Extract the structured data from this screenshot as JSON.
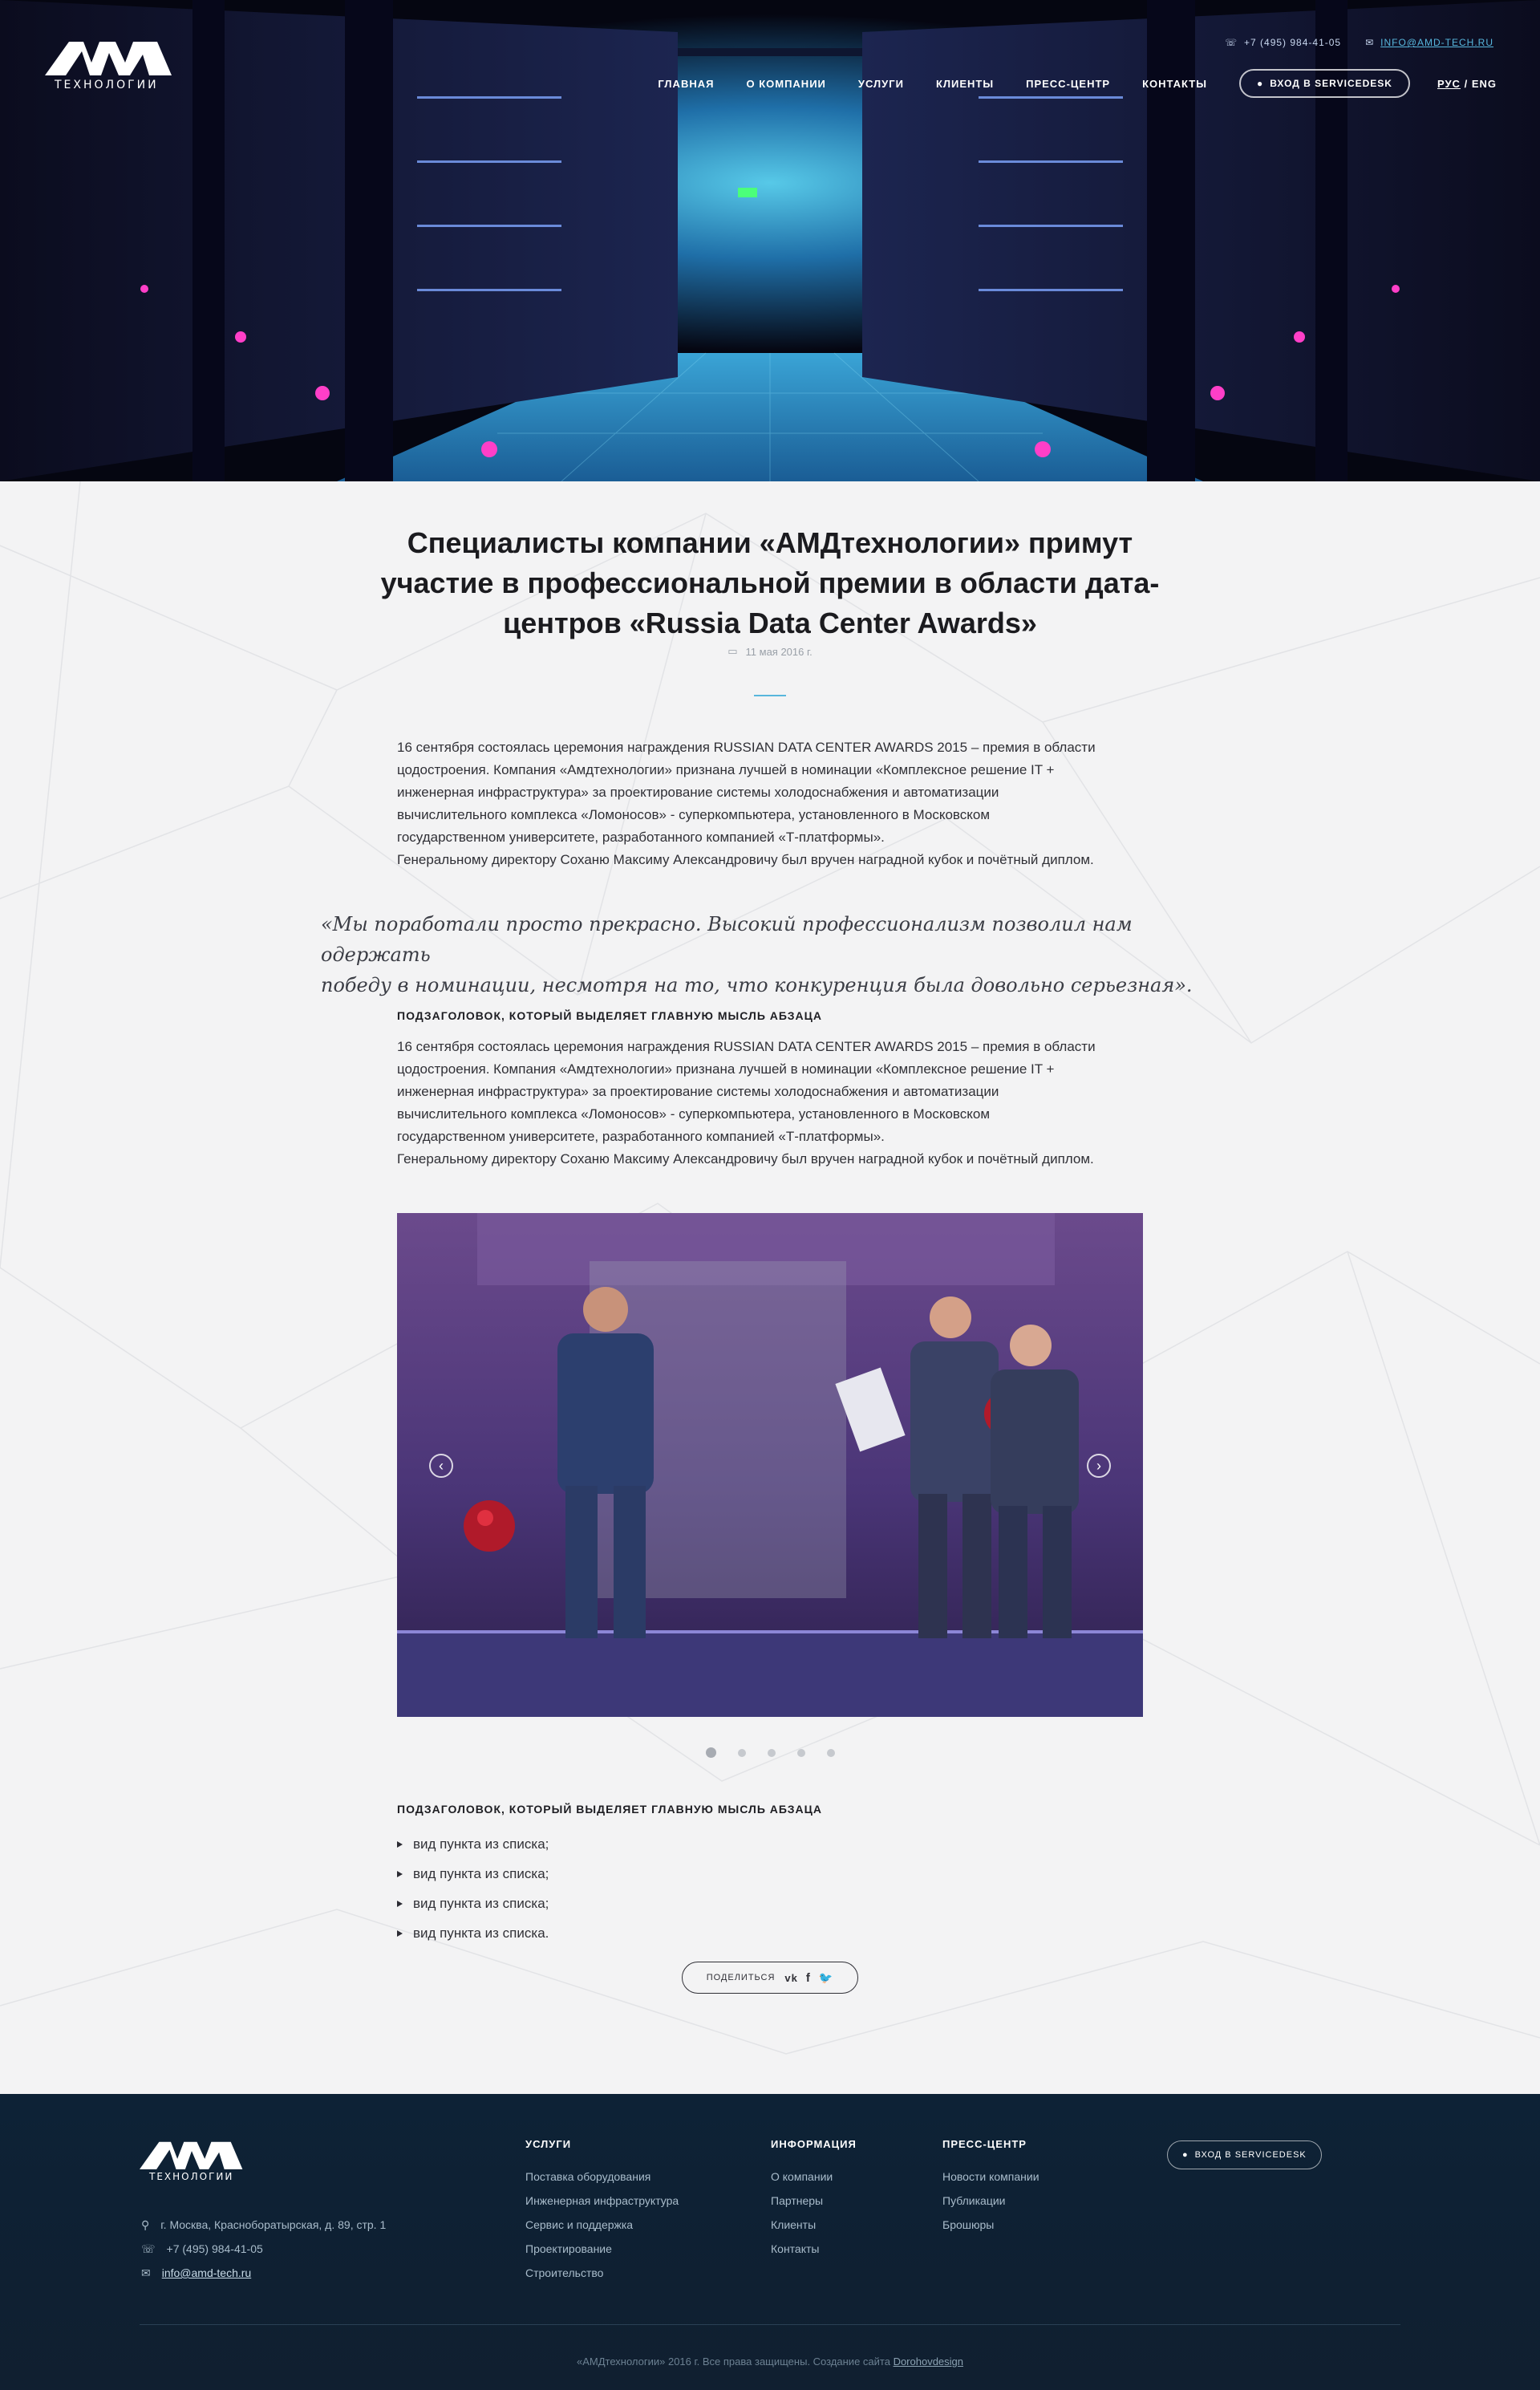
{
  "header": {
    "logo_text": "ТЕХНОЛОГИИ",
    "phone": "+7 (495) 984-41-05",
    "email": "INFO@AMD-TECH.RU",
    "nav": [
      "ГЛАВНАЯ",
      "О КОМПАНИИ",
      "УСЛУГИ",
      "КЛИЕНТЫ",
      "ПРЕСС-ЦЕНТР",
      "КОНТАКТЫ"
    ],
    "servicedesk_label": "ВХОД В SERVICEDESK",
    "lang_ru": "РУС",
    "lang_sep": "/",
    "lang_en": "ENG"
  },
  "article": {
    "title": "Специалисты компании «АМДтехнологии» примут участие в профессиональной премии в области дата-центров «Russia Data Center Awards»",
    "date": "11 мая 2016 г.",
    "paragraph1_lines": [
      "16 сентября состоялась церемония награждения RUSSIAN DATA CENTER AWARDS 2015 – премия в области",
      "цодостроения. Компания «Амдтехнологии» признана лучшей в номинации «Комплексное решение IT +",
      "инженерная инфраструктура» за проектирование системы холодоснабжения и автоматизации",
      "вычислительного комплекса «Ломоносов» - суперкомпьютера, установленного в Московском",
      "государственном университете, разработанного компанией «Т-платформы».",
      "Генеральному директору Соханю Максиму Александровичу был вручен наградной кубок и почётный диплом."
    ],
    "quote_lines": [
      "«Мы поработали просто прекрасно. Высокий профессионализм позволил нам одержать",
      "победу в номинации, несмотря на то, что конкуренция была довольно серьезная»."
    ],
    "subheading1": "ПОДЗАГОЛОВОК, КОТОРЫЙ ВЫДЕЛЯЕТ ГЛАВНУЮ МЫСЛЬ АБЗАЦА",
    "paragraph2_lines": [
      "16 сентября состоялась церемония награждения RUSSIAN DATA CENTER AWARDS 2015 – премия в области",
      "цодостроения. Компания «Амдтехнологии» признана лучшей в номинации «Комплексное решение IT +",
      "инженерная инфраструктура» за проектирование системы холодоснабжения и автоматизации",
      "вычислительного комплекса «Ломоносов» - суперкомпьютера, установленного в Московском",
      "государственном университете, разработанного компанией «Т-платформы».",
      "Генеральному директору Соханю Максиму Александровичу был вручен наградной кубок и почётный диплом."
    ],
    "slider": {
      "total_slides": 5,
      "active_slide": 1
    },
    "subheading2": "ПОДЗАГОЛОВОК, КОТОРЫЙ ВЫДЕЛЯЕТ ГЛАВНУЮ МЫСЛЬ АБЗАЦА",
    "list": [
      "вид пункта из списка;",
      "вид пункта из списка;",
      "вид пункта из списка;",
      "вид пункта из списка."
    ],
    "share_label": "ПОДЕЛИТЬСЯ"
  },
  "footer": {
    "logo_text": "ТЕХНОЛОГИИ",
    "address": "г. Москва, Красноборатырская, д. 89, стр. 1",
    "phone": "+7 (495) 984-41-05",
    "email": "info@amd-tech.ru",
    "col_services": {
      "title": "УСЛУГИ",
      "links": [
        "Поставка оборудования",
        "Инженерная инфраструктура",
        "Сервис и поддержка",
        "Проектирование",
        "Строительство"
      ]
    },
    "col_info": {
      "title": "ИНФОРМАЦИЯ",
      "links": [
        "О компании",
        "Партнеры",
        "Клиенты",
        "Контакты"
      ]
    },
    "col_press": {
      "title": "ПРЕСС-ЦЕНТР",
      "links": [
        "Новости компании",
        "Публикации",
        "Брошюры"
      ]
    },
    "servicedesk_label": "ВХОД В SERVICEDESK",
    "copyright": "«АМДтехнологии» 2016 г. Все права защищены. Создание сайта",
    "copyright_link": "Dorohovdesign"
  },
  "colors": {
    "accent": "#57b6dc",
    "footer_bg": "#0d2236",
    "page_bg": "#f3f3f4"
  }
}
